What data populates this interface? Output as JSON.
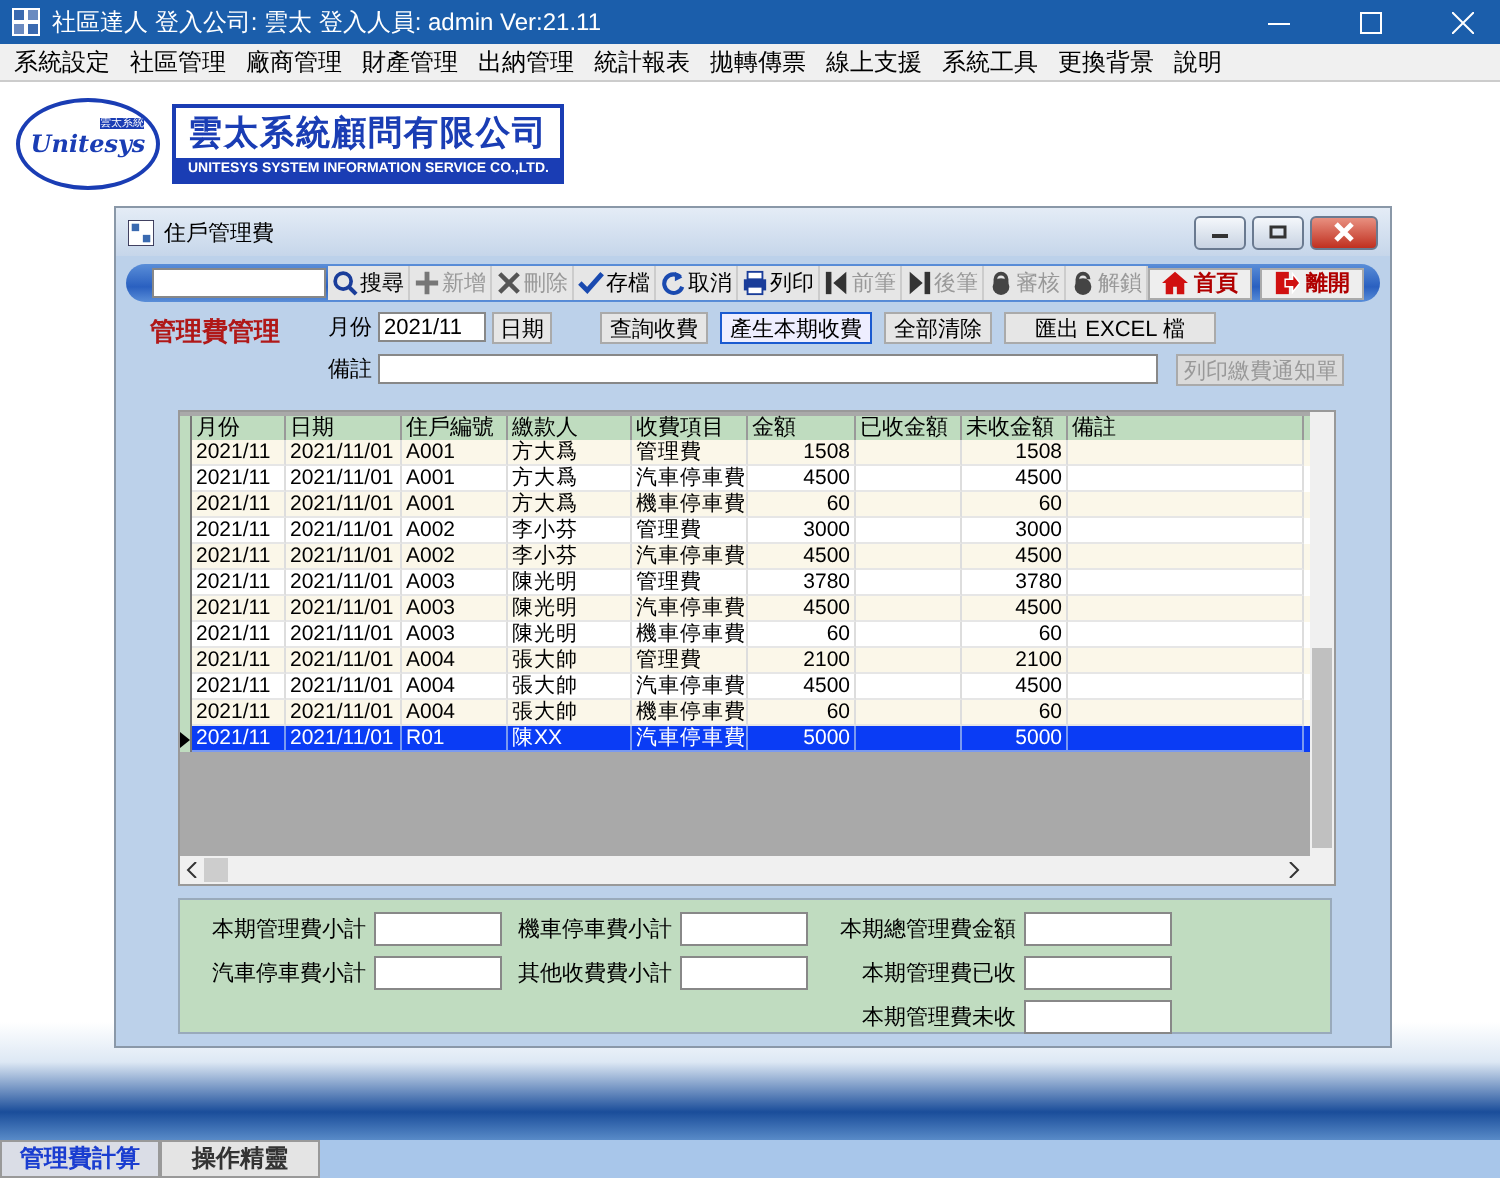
{
  "window": {
    "title": "社區達人  登入公司: 雲太  登入人員: admin Ver:21.11"
  },
  "menu": [
    "系統設定",
    "社區管理",
    "廠商管理",
    "財產管理",
    "出納管理",
    "統計報表",
    "拋轉傳票",
    "線上支援",
    "系統工具",
    "更換背景",
    "說明"
  ],
  "logo": {
    "emblem_script": "Unitesys",
    "emblem_tag": "雲太系統",
    "company": "雲太系統顧問有限公司",
    "company_en": "UNITESYS SYSTEM INFORMATION SERVICE CO.,LTD."
  },
  "child_window": {
    "title": "住戶管理費",
    "toolbar": [
      {
        "label": "搜尋",
        "kind": "search",
        "disabled": false
      },
      {
        "label": "新增",
        "kind": "add",
        "disabled": true
      },
      {
        "label": "刪除",
        "kind": "delete",
        "disabled": true
      },
      {
        "label": "存檔",
        "kind": "save",
        "disabled": false
      },
      {
        "label": "取消",
        "kind": "cancel",
        "disabled": false
      },
      {
        "label": "列印",
        "kind": "print",
        "disabled": false
      },
      {
        "label": "前筆",
        "kind": "previous",
        "disabled": true
      },
      {
        "label": "後筆",
        "kind": "next",
        "disabled": true
      },
      {
        "label": "審核",
        "kind": "approve",
        "disabled": true
      },
      {
        "label": "解鎖",
        "kind": "unlock",
        "disabled": true
      }
    ],
    "nav_buttons": [
      {
        "label": "首頁",
        "kind": "home"
      },
      {
        "label": "離開",
        "kind": "exit"
      }
    ],
    "heading": "管理費管理",
    "month_label": "月份",
    "month_value": "2021/11",
    "date_button": "日期",
    "actions": [
      {
        "label": "查詢收費",
        "focused": false
      },
      {
        "label": "產生本期收費",
        "focused": true
      },
      {
        "label": "全部清除",
        "focused": false
      },
      {
        "label": "匯出 EXCEL 檔",
        "focused": false
      }
    ],
    "note_label": "備註",
    "print_notice_button": {
      "label": "列印繳費通知單",
      "disabled": true
    },
    "table": {
      "columns": [
        "月份",
        "日期",
        "住戶編號",
        "繳款人",
        "收費項目",
        "金額",
        "已收金額",
        "未收金額",
        "備註"
      ],
      "rows": [
        {
          "month": "2021/11",
          "date": "2021/11/01",
          "household_no": "A001",
          "payer": "方大爲",
          "fee_item": "管理費",
          "amount": "1508",
          "unpaid": "1508",
          "selected": false
        },
        {
          "month": "2021/11",
          "date": "2021/11/01",
          "household_no": "A001",
          "payer": "方大爲",
          "fee_item": "汽車停車費",
          "amount": "4500",
          "unpaid": "4500",
          "selected": false
        },
        {
          "month": "2021/11",
          "date": "2021/11/01",
          "household_no": "A001",
          "payer": "方大爲",
          "fee_item": "機車停車費",
          "amount": "60",
          "unpaid": "60",
          "selected": false
        },
        {
          "month": "2021/11",
          "date": "2021/11/01",
          "household_no": "A002",
          "payer": "李小芬",
          "fee_item": "管理費",
          "amount": "3000",
          "unpaid": "3000",
          "selected": false
        },
        {
          "month": "2021/11",
          "date": "2021/11/01",
          "household_no": "A002",
          "payer": "李小芬",
          "fee_item": "汽車停車費",
          "amount": "4500",
          "unpaid": "4500",
          "selected": false
        },
        {
          "month": "2021/11",
          "date": "2021/11/01",
          "household_no": "A003",
          "payer": "陳光明",
          "fee_item": "管理費",
          "amount": "3780",
          "unpaid": "3780",
          "selected": false
        },
        {
          "month": "2021/11",
          "date": "2021/11/01",
          "household_no": "A003",
          "payer": "陳光明",
          "fee_item": "汽車停車費",
          "amount": "4500",
          "unpaid": "4500",
          "selected": false
        },
        {
          "month": "2021/11",
          "date": "2021/11/01",
          "household_no": "A003",
          "payer": "陳光明",
          "fee_item": "機車停車費",
          "amount": "60",
          "unpaid": "60",
          "selected": false
        },
        {
          "month": "2021/11",
          "date": "2021/11/01",
          "household_no": "A004",
          "payer": "張大帥",
          "fee_item": "管理費",
          "amount": "2100",
          "unpaid": "2100",
          "selected": false
        },
        {
          "month": "2021/11",
          "date": "2021/11/01",
          "household_no": "A004",
          "payer": "張大帥",
          "fee_item": "汽車停車費",
          "amount": "4500",
          "unpaid": "4500",
          "selected": false
        },
        {
          "month": "2021/11",
          "date": "2021/11/01",
          "household_no": "A004",
          "payer": "張大帥",
          "fee_item": "機車停車費",
          "amount": "60",
          "unpaid": "60",
          "selected": false
        },
        {
          "month": "2021/11",
          "date": "2021/11/01",
          "household_no": "R01",
          "payer": "陳XX",
          "fee_item": "汽車停車費",
          "amount": "5000",
          "unpaid": "5000",
          "selected": true
        }
      ]
    },
    "summary": [
      [
        {
          "label": "本期管理費小計"
        },
        {
          "label": "汽車停車費小計"
        }
      ],
      [
        {
          "label": "機車停車費小計"
        },
        {
          "label": "其他收費費小計"
        }
      ],
      [
        {
          "label": "本期總管理費金額"
        },
        {
          "label": "本期管理費已收"
        },
        {
          "label": "本期管理費未收"
        }
      ]
    ]
  },
  "bottom_tabs": [
    {
      "label": "管理費計算",
      "selected": true
    },
    {
      "label": "操作精靈",
      "selected": false
    }
  ]
}
